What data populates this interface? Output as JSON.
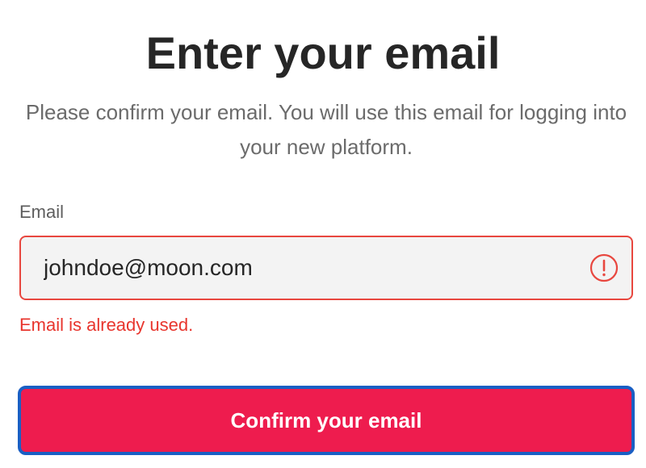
{
  "header": {
    "title": "Enter your email",
    "subtitle": "Please confirm your email. You will use this email for logging into your new platform."
  },
  "form": {
    "email_label": "Email",
    "email_value": "johndoe@moon.com",
    "error_message": "Email is already used.",
    "error_icon": "alert-circle-icon",
    "submit_label": "Confirm your email"
  },
  "colors": {
    "error": "#e8352d",
    "button_background": "#ee1c4e",
    "button_focus_border": "#1a5fc4",
    "input_background": "#f3f3f3"
  }
}
